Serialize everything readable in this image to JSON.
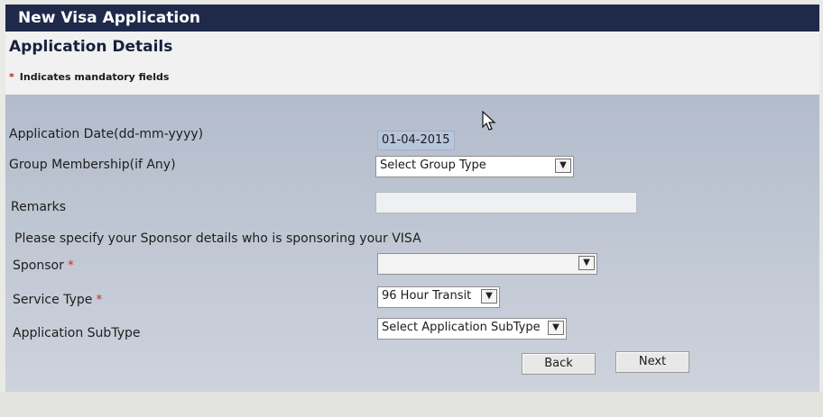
{
  "window": {
    "title": "New Visa Application"
  },
  "section": {
    "title": "Application Details",
    "mandatory_star": "*",
    "mandatory_note": "Indicates mandatory fields"
  },
  "form": {
    "application_date": {
      "label": "Application Date(dd-mm-yyyy)",
      "value": "01-04-2015"
    },
    "group_membership": {
      "label": "Group Membership(if Any)",
      "value": "Select Group Type"
    },
    "remarks": {
      "label": "Remarks",
      "value": ""
    },
    "sponsor_note": "Please specify your Sponsor details who is sponsoring your VISA",
    "sponsor": {
      "label": "Sponsor",
      "required_mark": "*",
      "value": ""
    },
    "service_type": {
      "label": "Service Type",
      "required_mark": "*",
      "value": "96 Hour Transit"
    },
    "application_subtype": {
      "label": "Application SubType",
      "value": "Select Application SubType"
    }
  },
  "buttons": {
    "back": "Back",
    "next": "Next"
  },
  "icons": {
    "dropdown": "chevron-down-icon",
    "pointer": "mouse-pointer-icon"
  },
  "colors": {
    "title_bar": "#1f2a4a",
    "panel": "#b3bccc",
    "required_star": "#d03030"
  }
}
